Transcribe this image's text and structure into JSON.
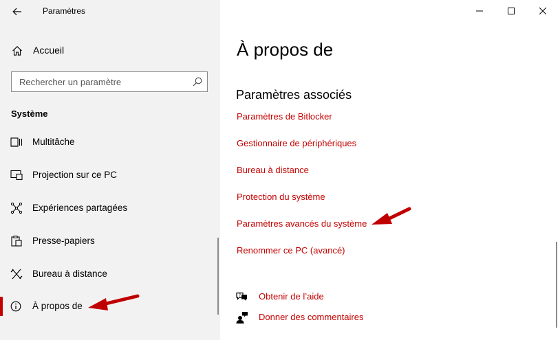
{
  "app": {
    "title": "Paramètres"
  },
  "sidebar": {
    "home_label": "Accueil",
    "search_placeholder": "Rechercher un paramètre",
    "section_title": "Système",
    "items": [
      {
        "label": "Multitâche",
        "icon": "multitask-icon"
      },
      {
        "label": "Projection sur ce PC",
        "icon": "projection-icon"
      },
      {
        "label": "Expériences partagées",
        "icon": "shared-experiences-icon"
      },
      {
        "label": "Presse-papiers",
        "icon": "clipboard-icon"
      },
      {
        "label": "Bureau à distance",
        "icon": "remote-desktop-icon"
      },
      {
        "label": "À propos de",
        "icon": "info-icon",
        "selected": true
      }
    ]
  },
  "main": {
    "title": "À propos de",
    "related_title": "Paramètres associés",
    "links": [
      "Paramètres de Bitlocker",
      "Gestionnaire de périphériques",
      "Bureau à distance",
      "Protection du système",
      "Paramètres avancés du système",
      "Renommer ce PC (avancé)"
    ],
    "help": [
      {
        "label": "Obtenir de l’aide",
        "icon": "help-chat-icon"
      },
      {
        "label": "Donner des commentaires",
        "icon": "feedback-icon"
      }
    ]
  },
  "colors": {
    "accent": "#c50000",
    "sidebar_bg": "#f2f2f2",
    "annotation_arrow": "#c00000"
  }
}
